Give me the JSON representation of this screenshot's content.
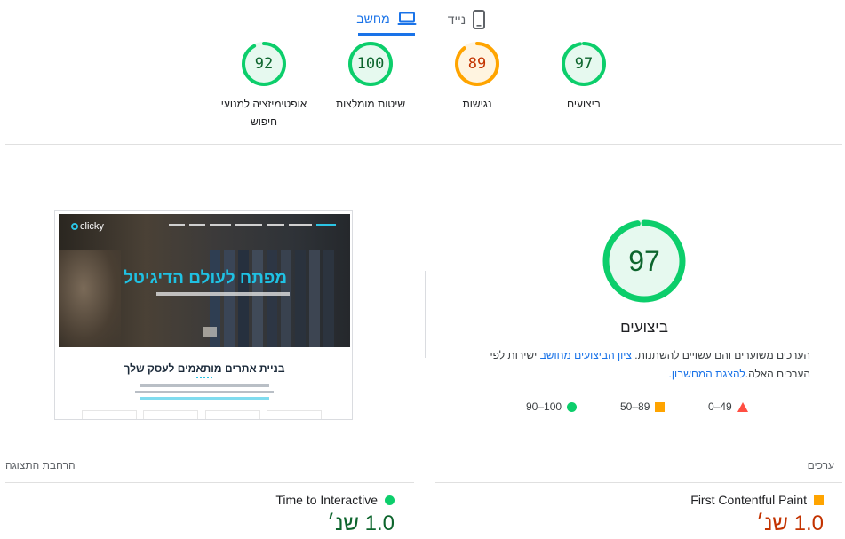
{
  "tabs": {
    "desktop_label": "מחשב",
    "mobile_label": "נייד",
    "active": "desktop"
  },
  "categories": [
    {
      "key": "performance",
      "label": "ביצועים",
      "score": "97",
      "score_value": 97,
      "color": "#0cce6b",
      "text_color": "#0d652d",
      "track": "#e6f9ef"
    },
    {
      "key": "accessibility",
      "label": "נגישות",
      "score": "89",
      "score_value": 89,
      "color": "#ffa400",
      "text_color": "#c33300",
      "track": "#fff4e0"
    },
    {
      "key": "best_practices",
      "label": "שיטות מומלצות",
      "score": "100",
      "score_value": 100,
      "color": "#0cce6b",
      "text_color": "#0d652d",
      "track": "#e6f9ef"
    },
    {
      "key": "seo",
      "label": "אופטימיזציה למנועי חיפוש",
      "score": "92",
      "score_value": 92,
      "color": "#0cce6b",
      "text_color": "#0d652d",
      "track": "#e6f9ef"
    }
  ],
  "performance_panel": {
    "score": "97",
    "score_value": 97,
    "title": "ביצועים",
    "desc_part1": "הערכים משוערים והם עשויים להשתנות. ",
    "desc_link1": "ציון הביצועים מחושב",
    "desc_part2": " ישירות לפי הערכים האלה.",
    "desc_link2": "להצגת המחשבון.",
    "legend": {
      "fail": "0–49",
      "average": "50–89",
      "pass": "90–100"
    }
  },
  "screenshot": {
    "logo_text": "clicky",
    "headline": "מפתח לעולם הדיגיטל",
    "heading": "בניית אתרים מותאמים לעסק שלך"
  },
  "metrics": {
    "section_label": "ערכים",
    "expand_label": "הרחבת התצוגה",
    "items": [
      {
        "key": "fcp",
        "name": "First Contentful Paint",
        "value": "1.0 שנ׳",
        "status": "average"
      },
      {
        "key": "tti",
        "name": "Time to Interactive",
        "value": "1.0 שנ׳",
        "status": "pass"
      }
    ]
  },
  "colors": {
    "pass": "#0cce6b",
    "average": "#ffa400",
    "fail": "#ff4e42",
    "link": "#1a73e8"
  },
  "icons": {
    "desktop": "laptop-icon",
    "mobile": "smartphone-icon"
  }
}
